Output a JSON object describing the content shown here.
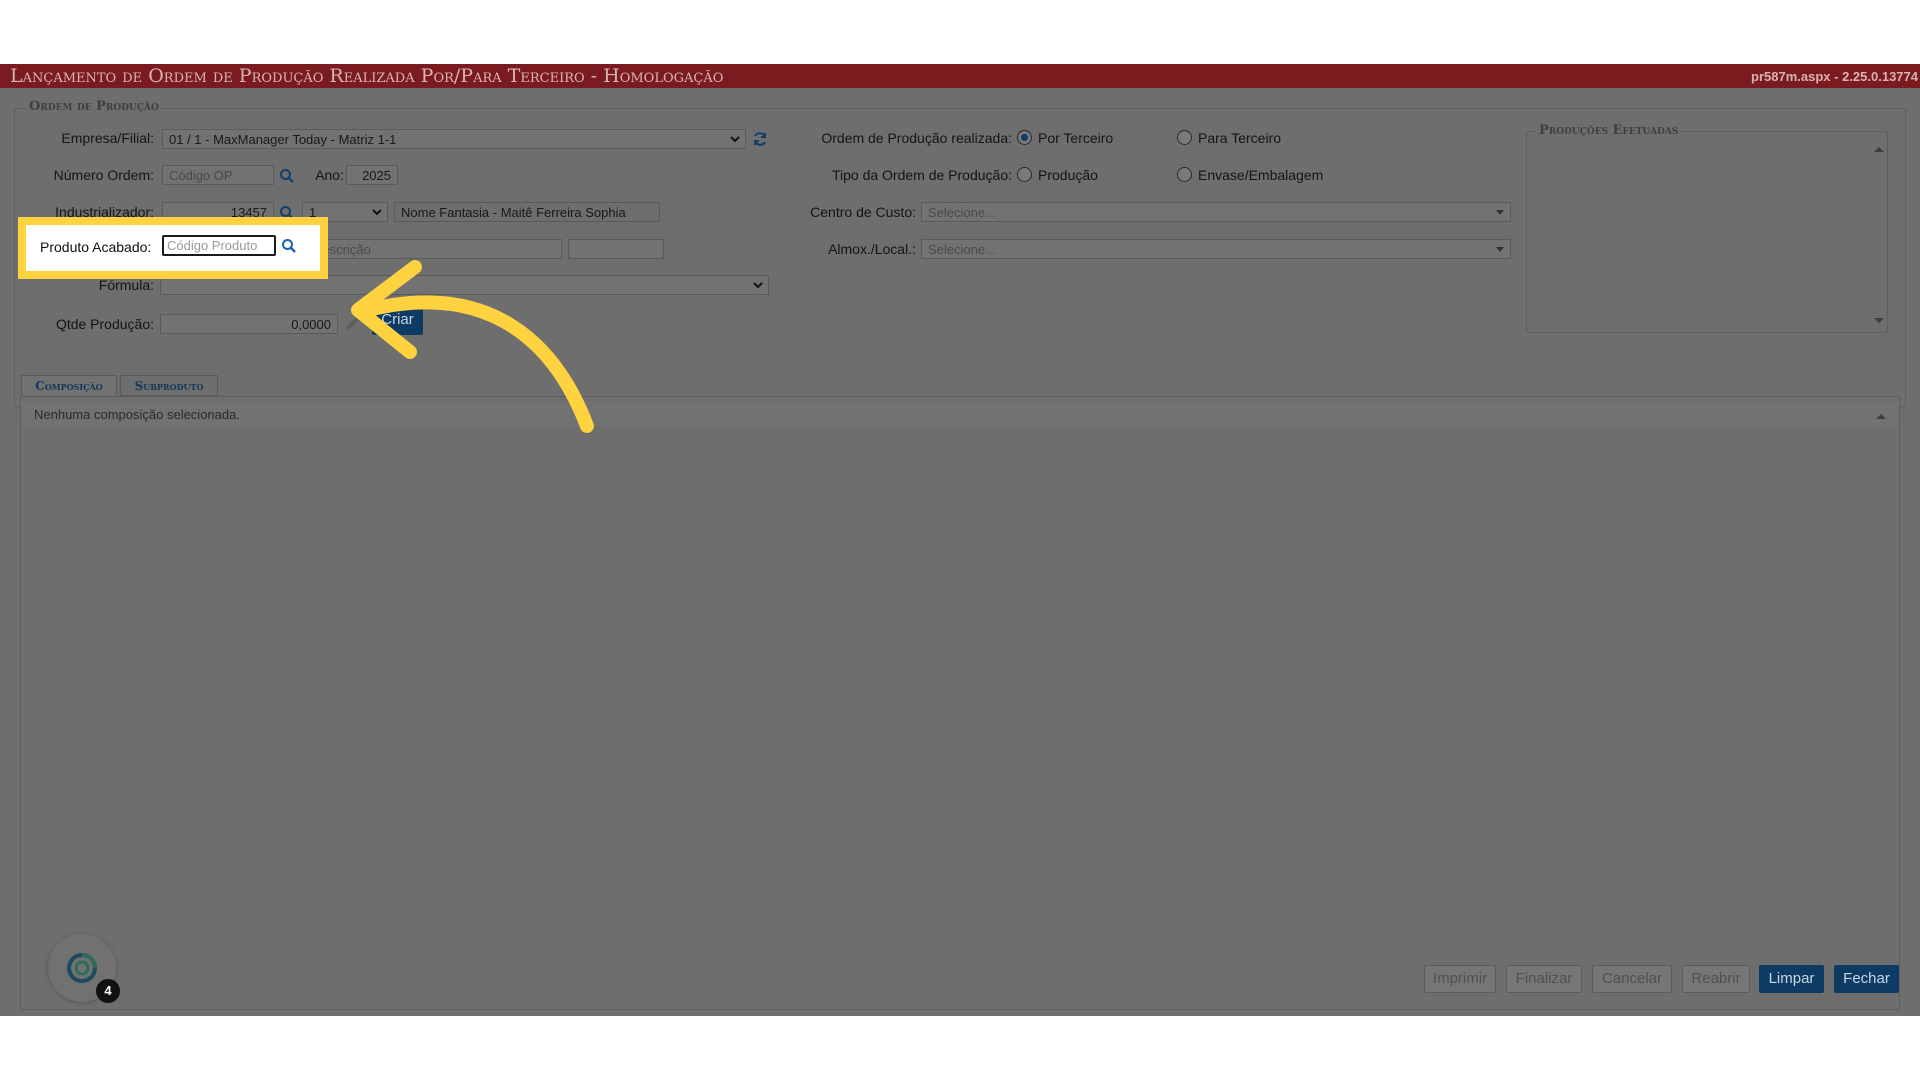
{
  "window": {
    "title": "Lançamento de Ordem de Produção Realizada Por/Para Terceiro  - Homologação",
    "version": "pr587m.aspx - 2.25.0.13774"
  },
  "order_panel": {
    "legend": "Ordem de Produção",
    "empresa": {
      "label": "Empresa/Filial:",
      "value": "01 / 1 - MaxManager Today - Matriz 1-1"
    },
    "numero": {
      "label": "Número Ordem:",
      "placeholder": "Código OP"
    },
    "ano": {
      "label": "Ano:",
      "value": "2025"
    },
    "industrializador": {
      "label": "Industrializador:",
      "code": "13457",
      "seq": "1",
      "name": "Nome Fantasia - Maitê Ferreira Sophia"
    },
    "produto": {
      "label": "Produto Acabado:",
      "placeholder": "Código Produto",
      "desc_placeholder": "Descrição"
    },
    "formula": {
      "label": "Fórmula:",
      "value": ""
    },
    "qtde": {
      "label": "Qtde Produção:",
      "value": "0,0000"
    },
    "criar_label": "Criar",
    "realizada": {
      "label": "Ordem de Produção realizada:",
      "opt1": "Por Terceiro",
      "opt2": "Para Terceiro",
      "selected": "Por Terceiro"
    },
    "tipo": {
      "label": "Tipo da Ordem de Produção:",
      "opt1": "Produção",
      "opt2": "Envase/Embalagem"
    },
    "centro": {
      "label": "Centro de Custo:",
      "value": "Selecione..."
    },
    "almox": {
      "label": "Almox./Local.:",
      "value": "Selecione..."
    }
  },
  "producoes": {
    "legend": "Produções Efetuadas"
  },
  "tabs": [
    {
      "label": "Composição",
      "active": true
    },
    {
      "label": "Subproduto",
      "active": false
    }
  ],
  "composition": {
    "empty_message": "Nenhuma composição selecionada."
  },
  "footer_buttons": {
    "imprimir": "Imprimir",
    "finalizar": "Finalizar",
    "cancelar": "Cancelar",
    "reabrir": "Reabrir",
    "limpar": "Limpar",
    "fechar": "Fechar"
  },
  "notification": {
    "count": "4"
  },
  "colors": {
    "titlebar": "#7a1c1f",
    "overlay": "#6e6e6e",
    "highlight_border": "#ffd23f",
    "arrow": "#ffd23f",
    "primary_button": "#0d3b63"
  },
  "icons": [
    "search-icon",
    "refresh-icon",
    "chevron-down-icon",
    "pencil-icon",
    "chevron-up-icon",
    "app-logo-icon",
    "arrow-annotation-icon"
  ]
}
